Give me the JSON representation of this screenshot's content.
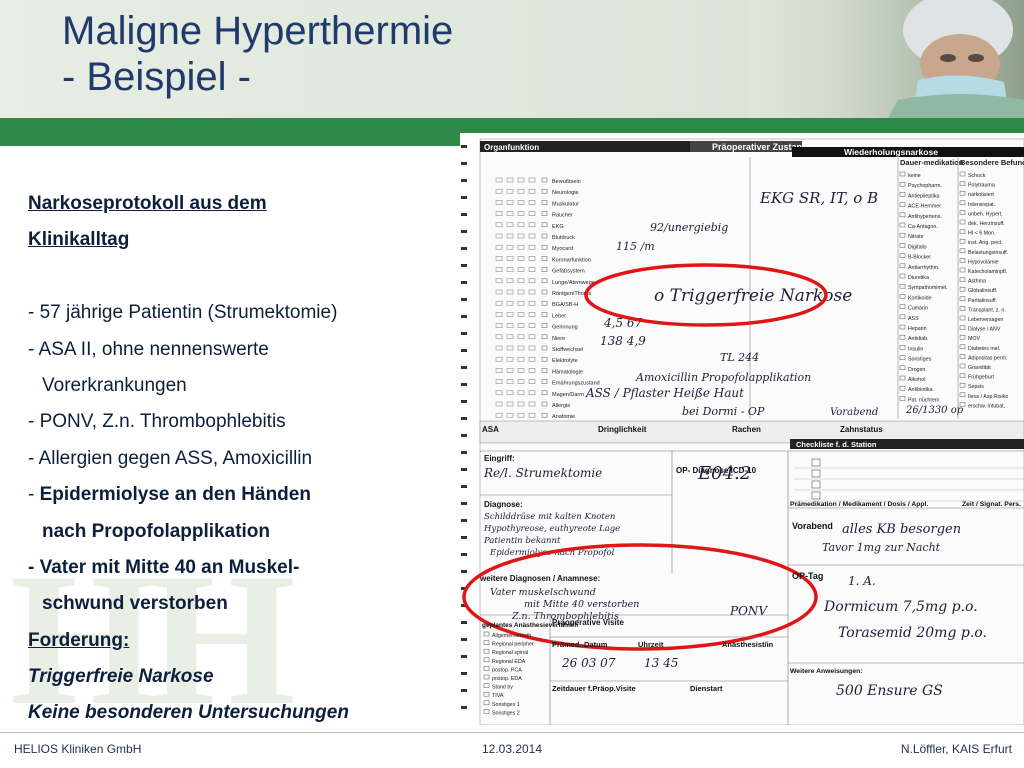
{
  "slide": {
    "title_line1": "Maligne Hyperthermie",
    "title_line2": "- Beispiel -"
  },
  "content": {
    "heading1": "Narkoseprotokoll aus dem",
    "heading2": "Klinikalltag",
    "items": [
      "- 57 jährige Patientin (Strumektomie)",
      "- ASA II, ohne nennenswerte",
      "Vorerkrankungen",
      "- PONV, Z.n. Thrombophlebitis",
      "- Allergien gegen ASS, Amoxicillin"
    ],
    "item6_dash": "- ",
    "item6_bold": "Epidermiolyse an den Händen",
    "item6_cont": "nach Propofolapplikation",
    "item7": "- Vater mit Mitte 40 an Muskel-",
    "item7_cont": "schwund verstorben",
    "forderung_label": "Forderung:",
    "requirement1": "Triggerfreie Narkose",
    "requirement2": "Keine besonderen Untersuchungen"
  },
  "form": {
    "header_organfunktion": "Organfunktion",
    "header_praeop": "Präoperativer Zustand",
    "header_wiederholung": "Wiederholungsnarkose",
    "dauer_medikation": "Dauer-medikation",
    "besondere_befunde": "Besondere Befunde Risiken",
    "organ_rows": [
      "Bewußtsein",
      "Neurologie",
      "Muskulatur",
      "Raucher",
      "EKG",
      "Blutdruck",
      "Myocard",
      "Koronarfunktion",
      "Gefäßsystem",
      "Lunge/Atemwege",
      "Röntgen/Thorax",
      "BGA/SB-H",
      "Leber",
      "Gerinnung",
      "Niere",
      "Stoffwechsel",
      "Elektrolyte",
      "Hämatologie",
      "Ernährungszustand",
      "Magen/Darm",
      "Allergie",
      "Anatomie"
    ],
    "med_rows": [
      "keine",
      "Psychopharm.",
      "Antiepileptika",
      "ACE-Hemmer",
      "Antihypertens.",
      "Ca-Antagon.",
      "Nitrate",
      "Digitalis",
      "B-Blocker",
      "Antiarrhythm.",
      "Diuretika",
      "Sympathomimet.",
      "Kortikoide",
      "Cumarin",
      "ASS",
      "Heparin",
      "Antidiab.",
      "Insulin",
      "Sonstiges",
      "Drogen",
      "Alkohol",
      "Antibiotika",
      "Pat. nüchtern"
    ],
    "risk_rows": [
      "Schock",
      "Polytrauma",
      "narkotisiert",
      "Intensivpat.",
      "unbeh. Hypert.",
      "dek. Herzinsuff.",
      "HI < 6 Mon.",
      "inst. Ang. pect.",
      "Belastungsinsuff.",
      "Hypovolämie",
      "Katecholaminpfl.",
      "Asthma",
      "Globalinsuff.",
      "Partialinsuff.",
      "Transplant. z. n.",
      "Leberversagen",
      "Dialyse / ANV",
      "MOV",
      "Diabetes mel.",
      "Adipositas perm.",
      "Gravidität",
      "Frühgeburt",
      "Sepsis",
      "Ileus / Asp.Risiko",
      "erschw. Intubat."
    ],
    "hw_ekg": "EKG   SR, IT, o B",
    "hw_rr": "92/unergiebig",
    "hw_hf": "115 /m",
    "hw_trigger": "o Triggerfreie Narkose",
    "hw_lab1": "4,5   67",
    "hw_lab2": "138   4,9",
    "hw_lab3": "TL 244",
    "hw_allergy1": "Amoxicillin   Propofolapplikation",
    "hw_allergy2": "ASS / Pflaster   Heiße Haut",
    "hw_allergy3": "bei Dormi - OP",
    "hw_vorabend_top": "Vorabend",
    "hw_zeit": "26/1330 op",
    "asa_label": "ASA",
    "dringlichkeit": "Dringlichkeit",
    "rachen": "Rachen",
    "zahnstatus": "Zahnstatus",
    "checkliste": "Checkliste f. d. Station",
    "eingriff": "Eingriff:",
    "op_diagnose": "OP- Diagnose ICD-10",
    "hw_eingriff": "Re/l. Strumektomie",
    "hw_icd": "E04.2",
    "diagnose": "Diagnose:",
    "hw_diag1": "Schilddrüse mit kalten Knoten",
    "hw_diag2": "Hypothyreose, euthyreote Lage",
    "hw_diag3": "Patientin bekannt",
    "hw_diag4": "Epidermiolyse nach Propofol",
    "weitere_diagnosen": "weitere Diagnosen / Anamnese:",
    "hw_father1": "Vater muskelschwund",
    "hw_father2": "mit Mitte 40 verstorben",
    "hw_father3": "Z.n. Thrombophlebitis",
    "hw_ponv": "PONV",
    "praemedikation": "Prämedikation / Medikament / Dosis / Appl.",
    "zeit_signatur": "Zeit / Signat. Pers.",
    "vorabend": "Vorabend",
    "hw_vorabend": "alles KB besorgen",
    "hw_vorabend2": "Tavor 1mg zur Nacht",
    "op_tag": "OP-Tag",
    "hw_optag1": "1. A.",
    "hw_optag2": "Dormicum 7,5mg p.o.",
    "hw_optag3": "Torasemid 20mg p.o.",
    "weitere_anweisungen": "Weitere Anweisungen:",
    "hw_weitere": "500 Ensure GS",
    "geplantes_anaesthesie": "geplantes Anästhesieverfahren",
    "anaesthesie_opts": [
      "Allgemeinanästh.",
      "Regional peripher",
      "Regional spinal",
      "Regional EDA",
      "postop. PCA",
      "postop. EDA",
      "Stand by",
      "TIVA",
      "Sonstiges 1",
      "Sonstiges 2"
    ],
    "praeop_visite": "Präoperative Visite",
    "praemed_datum": "Prämed.-Datum",
    "uhrzeit": "Uhrzeit",
    "anaesthesist": "Anästhesist/in",
    "hw_datum": "26 03 07",
    "hw_uhrzeit": "13 45",
    "zeitdauer": "Zeitdauer f.Präop.Visite",
    "dienstart": "Dienstart"
  },
  "footer": {
    "left": "HELIOS Kliniken GmbH",
    "center": "12.03.2014",
    "right": "N.Löffler,  KAIS Erfurt"
  }
}
